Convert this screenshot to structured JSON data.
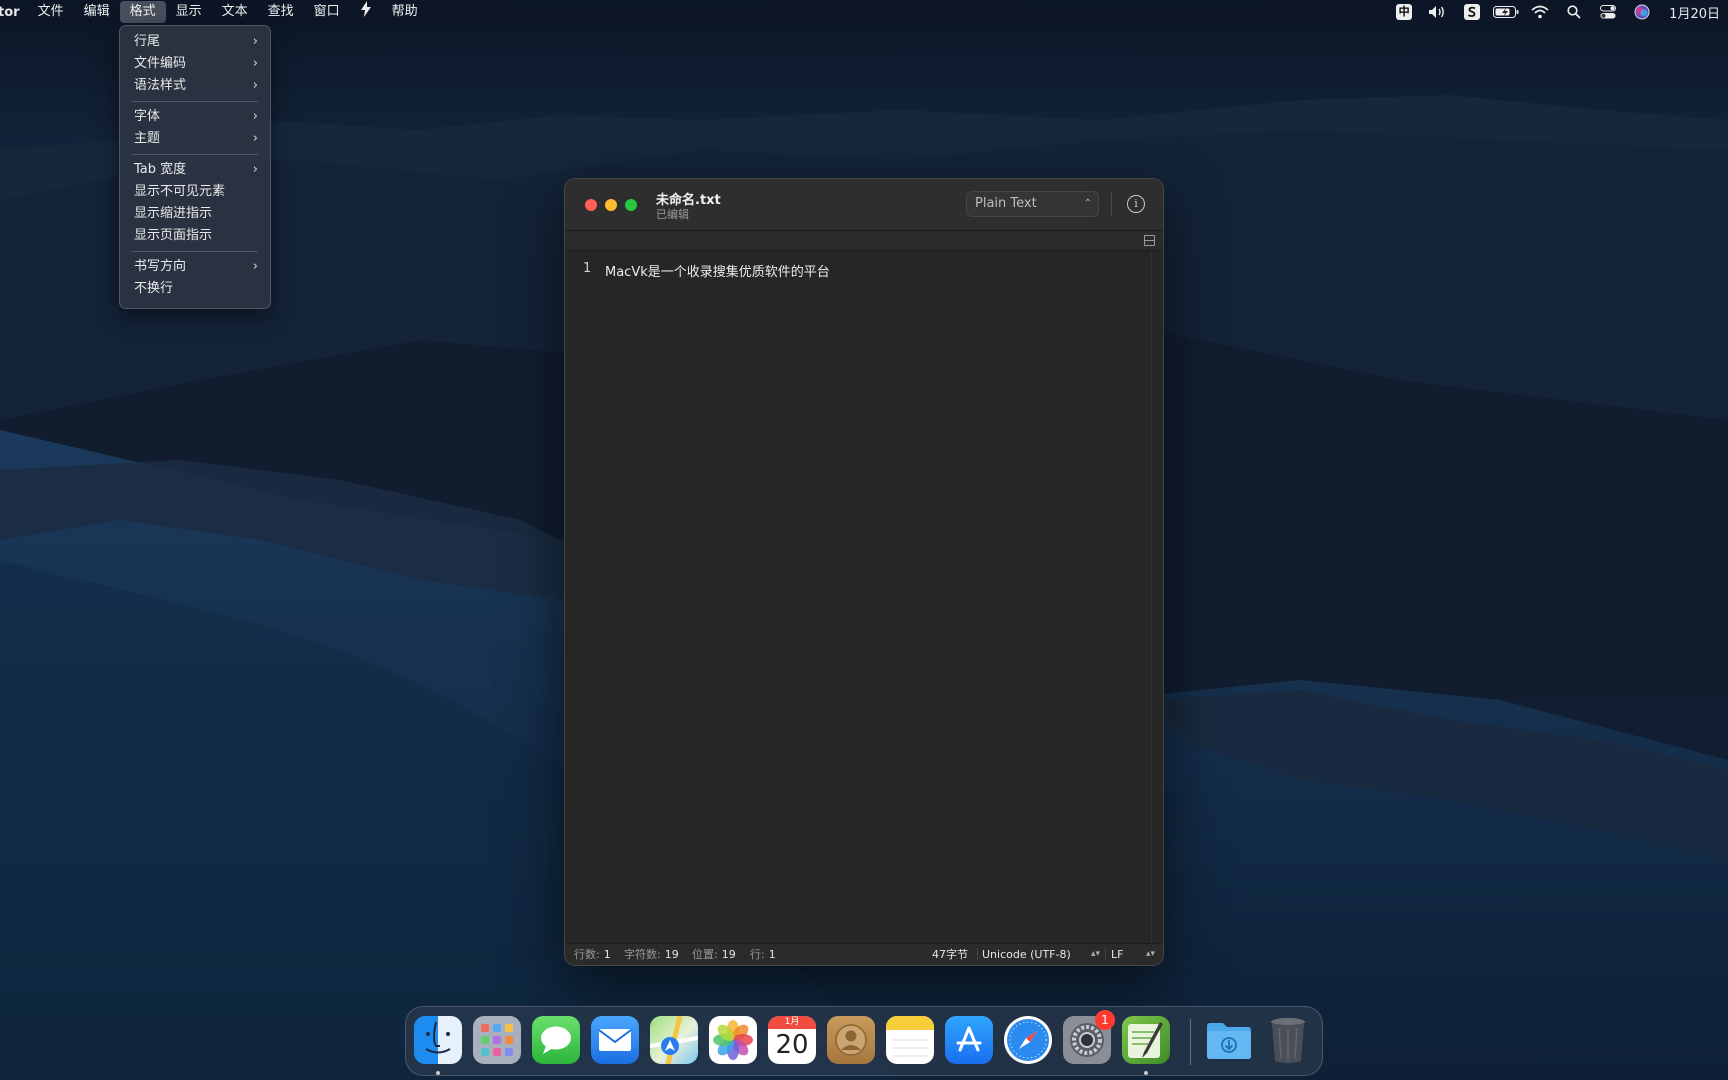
{
  "menubar": {
    "app_name": "tor",
    "menus": [
      "文件",
      "编辑",
      "格式",
      "显示",
      "文本",
      "查找",
      "窗口",
      "帮助"
    ],
    "active_menu": "格式",
    "status_icons": [
      "input-method-icon",
      "volume-icon",
      "sogou-icon",
      "battery-icon",
      "wifi-icon",
      "spotlight-icon",
      "control-center-icon",
      "siri-icon"
    ],
    "input_method_glyph": "中",
    "clock": "1月20日"
  },
  "format_menu": {
    "groups": [
      [
        {
          "label": "行尾",
          "submenu": true
        },
        {
          "label": "文件编码",
          "submenu": true
        },
        {
          "label": "语法样式",
          "submenu": true
        }
      ],
      [
        {
          "label": "字体",
          "submenu": true
        },
        {
          "label": "主题",
          "submenu": true
        }
      ],
      [
        {
          "label": "Tab 宽度",
          "submenu": true
        },
        {
          "label": "显示不可见元素",
          "submenu": false
        },
        {
          "label": "显示缩进指示",
          "submenu": false
        },
        {
          "label": "显示页面指示",
          "submenu": false
        }
      ],
      [
        {
          "label": "书写方向",
          "submenu": true
        },
        {
          "label": "不换行",
          "submenu": false
        }
      ]
    ]
  },
  "editor": {
    "title": "未命名.txt",
    "subtitle": "已编辑",
    "syntax": "Plain Text",
    "lines": [
      {
        "number": "1",
        "text": "MacVk是一个收录搜集优质软件的平台"
      }
    ],
    "status": {
      "lines_label": "行数:",
      "lines_value": "1",
      "chars_label": "字符数:",
      "chars_value": "19",
      "position_label": "位置:",
      "position_value": "19",
      "row_label": "行:",
      "row_value": "1",
      "bytes": "47字节",
      "encoding": "Unicode (UTF-8)",
      "line_ending": "LF"
    }
  },
  "dock": {
    "apps": [
      "finder",
      "launchpad",
      "messages",
      "mail",
      "maps",
      "photos",
      "calendar",
      "contacts",
      "notes",
      "app-store",
      "safari",
      "system-preferences",
      "coteditor"
    ],
    "calendar_month": "1月",
    "calendar_day": "20",
    "system_preferences_badge": "1"
  }
}
